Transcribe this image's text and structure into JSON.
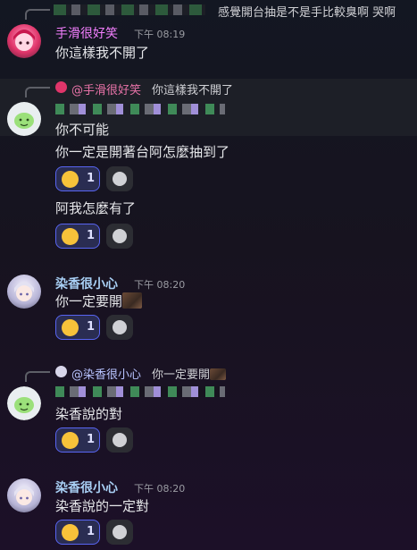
{
  "top_reply": {
    "text": "感覺開台抽是不是手比較臭啊 哭啊"
  },
  "msg1": {
    "author": "手滑很好笑",
    "time": "下午 08:19",
    "text": "你這樣我不開了"
  },
  "reply2": {
    "author": "@手滑很好笑",
    "text": "你這樣我不開了"
  },
  "msg2_lines": [
    "你不可能",
    "你一定是開著台阿怎麼抽到了",
    "阿我怎麼有了"
  ],
  "msg3": {
    "author": "染香很小心",
    "time": "下午 08:20",
    "text": "你一定要開"
  },
  "reply4": {
    "author": "@染香很小心",
    "text": "你一定要開"
  },
  "msg4_lines": [
    "染香說的對"
  ],
  "msg5": {
    "author": "染香很小心",
    "time": "下午 08:20",
    "text": "染香說的一定對"
  },
  "reaction": {
    "emoji": "rolling-on-floor-laughing",
    "count": "1"
  },
  "colors": {
    "pink_name": "#f47fff",
    "blue_name": "#a9d0f5",
    "accent": "#5865f2"
  }
}
